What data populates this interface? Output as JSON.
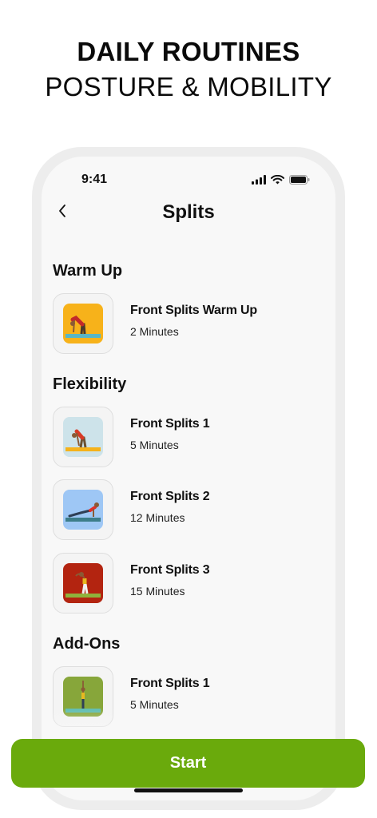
{
  "promo": {
    "line1": "DAILY ROUTINES",
    "line2": "POSTURE & MOBILITY"
  },
  "status_bar": {
    "time": "9:41",
    "icons": [
      "cellular-signal-icon",
      "wifi-icon",
      "battery-icon"
    ]
  },
  "nav": {
    "back_icon": "chevron-left-icon",
    "title": "Splits"
  },
  "sections": [
    {
      "title": "Warm Up",
      "items": [
        {
          "title": "Front Splits Warm Up",
          "subtitle": "2 Minutes",
          "thumb_bg": "#f7b21a",
          "mat": "#59b6c4"
        }
      ]
    },
    {
      "title": "Flexibility",
      "items": [
        {
          "title": "Front Splits 1",
          "subtitle": "5 Minutes",
          "thumb_bg": "#cde3ea",
          "mat": "#f5b21b"
        },
        {
          "title": "Front Splits 2",
          "subtitle": "12 Minutes",
          "thumb_bg": "#9ec7f5",
          "mat": "#3c7d8a"
        },
        {
          "title": "Front Splits 3",
          "subtitle": "15 Minutes",
          "thumb_bg": "#b32410",
          "mat": "#8fb23b"
        }
      ]
    },
    {
      "title": "Add-Ons",
      "items": [
        {
          "title": "Front Splits 1",
          "subtitle": "5 Minutes",
          "thumb_bg": "#87a63a",
          "mat": "#5fbcb0"
        }
      ]
    }
  ],
  "cta": {
    "label": "Start",
    "color": "#6aaa0c"
  }
}
